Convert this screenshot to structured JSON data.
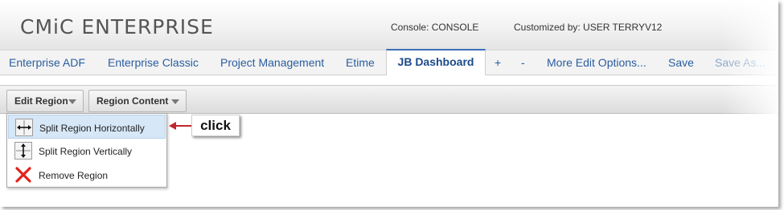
{
  "app": {
    "title": "CMiC ENTERPRISE",
    "console": "Console: CONSOLE",
    "customized_by": "Customized by: USER TERRYV12"
  },
  "tabs": [
    {
      "label": "Enterprise ADF"
    },
    {
      "label": "Enterprise Classic"
    },
    {
      "label": "Project Management"
    },
    {
      "label": "Etime"
    },
    {
      "label": "JB Dashboard",
      "active": true
    },
    {
      "label": "+"
    },
    {
      "label": "-"
    },
    {
      "label": "More Edit Options..."
    },
    {
      "label": "Save"
    },
    {
      "label": "Save As..."
    }
  ],
  "toolbar": {
    "edit_region": "Edit Region",
    "region_content": "Region Content"
  },
  "menu": {
    "items": [
      {
        "label": "Split Region Horizontally",
        "icon": "split-horizontal-icon",
        "highlighted": true
      },
      {
        "label": "Split Region Vertically",
        "icon": "split-vertical-icon"
      },
      {
        "label": "Remove Region",
        "icon": "remove-x-icon"
      }
    ]
  },
  "annotation": {
    "text": "click",
    "color": "#c0262d"
  },
  "colors": {
    "link": "#2a5d9f",
    "active_tab_border": "#3c6fb6",
    "highlight": "#d6e7f7"
  }
}
